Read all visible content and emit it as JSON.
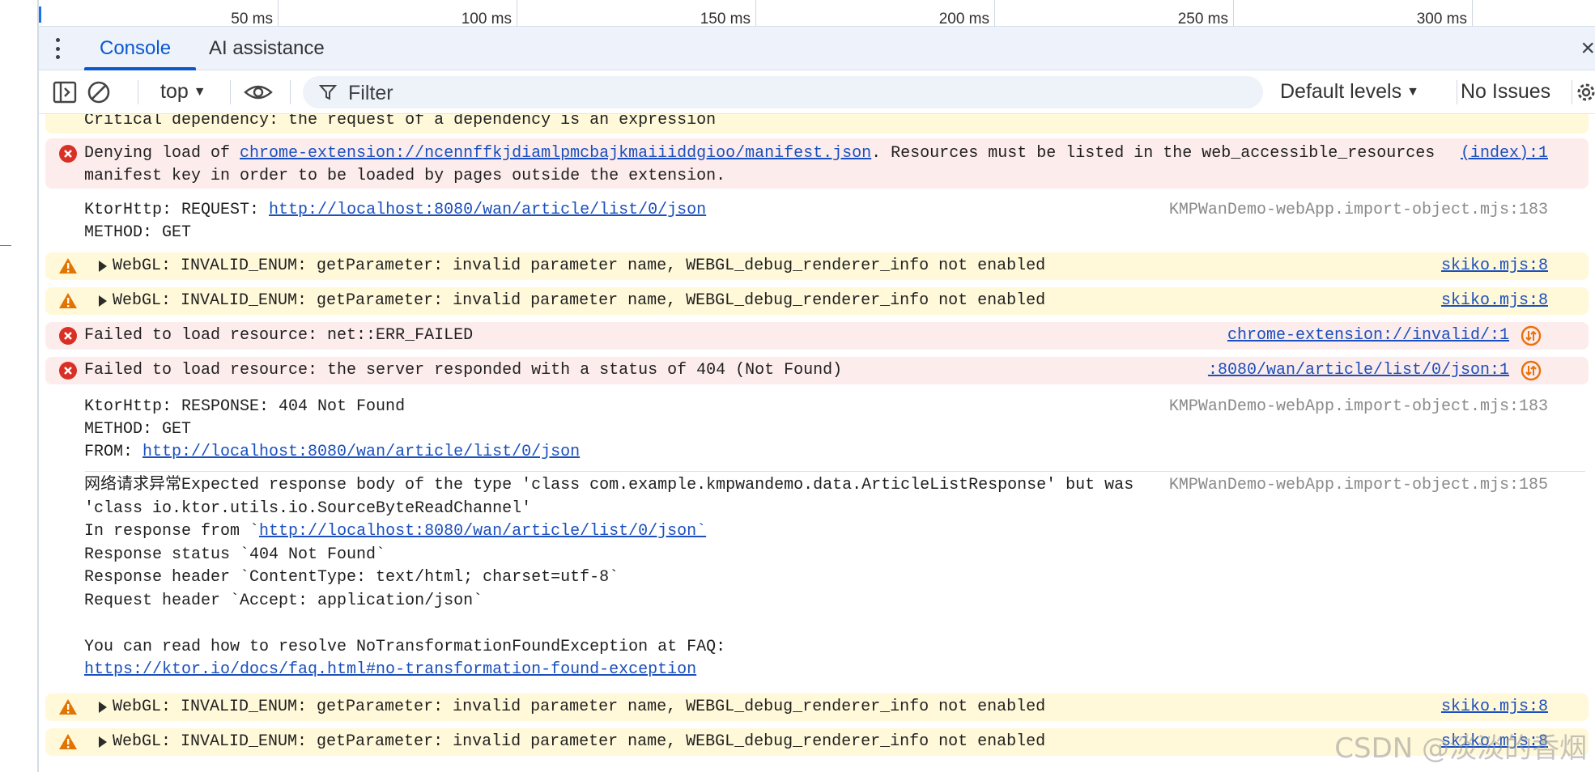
{
  "timeline": {
    "ticks": [
      "50 ms",
      "100 ms",
      "150 ms",
      "200 ms",
      "250 ms",
      "300 ms"
    ]
  },
  "tabs": {
    "console": "Console",
    "ai": "AI assistance",
    "close": "×"
  },
  "toolbar": {
    "context": "top",
    "filter_placeholder": "Filter",
    "levels": "Default levels",
    "issues": "No Issues"
  },
  "colors": {
    "warning_bg": "#fff8d9",
    "error_bg": "#fdecec",
    "link": "#1a4fbd",
    "accent": "#0b57d0"
  },
  "messages": {
    "m0": {
      "line1": "Critical dependency: the request of a dependency is an expression"
    },
    "m1": {
      "prefix": "Denying load of ",
      "link": "chrome-extension://ncennffkjdiamlpmcbajkmaiiiddgioo/manifest.json",
      "suffix": ". Resources must be listed in the web_accessible_resources",
      "line2": "manifest key in order to be loaded by pages outside the extension.",
      "source": "(index):1"
    },
    "m2": {
      "prefix": "KtorHttp: REQUEST: ",
      "link": "http://localhost:8080/wan/article/list/0/json",
      "line2": "METHOD: GET",
      "source": "KMPWanDemo-webApp.import-object.mjs:183"
    },
    "m3": {
      "text": "WebGL: INVALID_ENUM: getParameter: invalid parameter name, WEBGL_debug_renderer_info not enabled",
      "source": "skiko.mjs:8"
    },
    "m4": {
      "text": "WebGL: INVALID_ENUM: getParameter: invalid parameter name, WEBGL_debug_renderer_info not enabled",
      "source": "skiko.mjs:8"
    },
    "m5": {
      "text": "Failed to load resource: net::ERR_FAILED",
      "source": "chrome-extension://invalid/:1"
    },
    "m6": {
      "text": "Failed to load resource: the server responded with a status of 404 (Not Found)",
      "source": ":8080/wan/article/list/0/json:1"
    },
    "m7": {
      "line1": "KtorHttp: RESPONSE: 404 Not Found",
      "line2": "METHOD: GET",
      "prefix3": "FROM: ",
      "link": "http://localhost:8080/wan/article/list/0/json",
      "source": "KMPWanDemo-webApp.import-object.mjs:183"
    },
    "m8": {
      "line1": "网络请求异常Expected response body of the type 'class com.example.kmpwandemo.data.ArticleListResponse' but was",
      "line2": "'class io.ktor.utils.io.SourceByteReadChannel'",
      "prefix3": "In response from `",
      "link3": "http://localhost:8080/wan/article/list/0/json`",
      "line4": "Response status `404 Not Found`",
      "line5": "Response header `ContentType: text/html; charset=utf-8`",
      "line6": "Request header `Accept: application/json`",
      "line8": "You can read how to resolve NoTransformationFoundException at FAQ:",
      "link9": "https://ktor.io/docs/faq.html#no-transformation-found-exception",
      "source": "KMPWanDemo-webApp.import-object.mjs:185"
    },
    "m9": {
      "text": "WebGL: INVALID_ENUM: getParameter: invalid parameter name, WEBGL_debug_renderer_info not enabled",
      "source": "skiko.mjs:8"
    },
    "m10": {
      "text": "WebGL: INVALID_ENUM: getParameter: invalid parameter name, WEBGL_debug_renderer_info not enabled",
      "source": "skiko.mjs:8"
    }
  },
  "watermark": "CSDN @淡淡的香烟"
}
